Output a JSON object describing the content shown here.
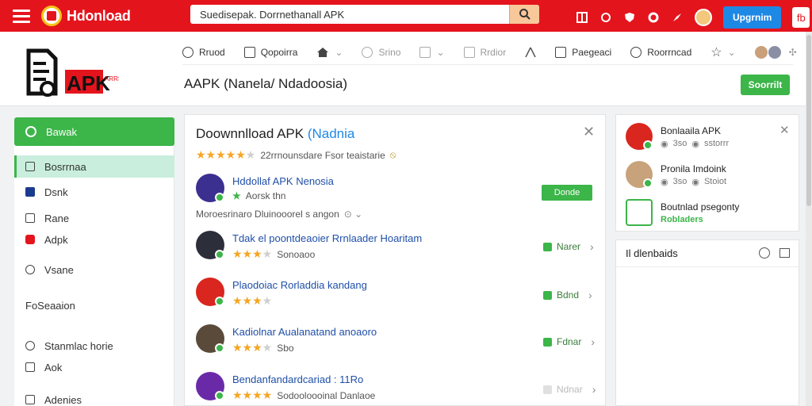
{
  "topbar": {
    "brand": "Hdonload",
    "search_value": "Suedisepak. Dorrnethanall APK",
    "upgrade_label": "Upgrnim",
    "square_label": "fb"
  },
  "nav": {
    "items": [
      {
        "label": "Rruod",
        "icon": "globe-icon"
      },
      {
        "label": "Qopoirra",
        "icon": "window-icon"
      },
      {
        "label": "",
        "icon": "home-icon"
      },
      {
        "label": "Srino",
        "icon": "search-icon"
      },
      {
        "label": "",
        "icon": "box-icon"
      },
      {
        "label": "Rrdior",
        "icon": "mail-icon"
      },
      {
        "label": "",
        "icon": "arrow-icon"
      },
      {
        "label": "Paegeaci",
        "icon": "page-icon"
      },
      {
        "label": "Roorrncad",
        "icon": "ring-icon"
      }
    ]
  },
  "header": {
    "logo_text": "APK",
    "logo_tag": "ARRS",
    "title": "AAPK (Nanela/ Ndadoosia)",
    "search_button": "Soorrilt"
  },
  "sidebar": {
    "primary_label": "Bawak",
    "items": [
      {
        "label": "Bosrrnaa",
        "icon": "box-icon",
        "active": true
      },
      {
        "label": "Dsnk",
        "icon": "flag-icon",
        "active": false
      },
      {
        "label": "Rane",
        "icon": "page-icon",
        "active": false
      },
      {
        "label": "Adpk",
        "icon": "apk-icon",
        "active": false
      },
      {
        "label": "Vsane",
        "icon": "search-icon",
        "active": false
      },
      {
        "label": "FoSeaaion",
        "icon": "",
        "active": false
      },
      {
        "label": "Stanmlac horie",
        "icon": "clock-icon",
        "active": false
      },
      {
        "label": "Aok",
        "icon": "grid-icon",
        "active": false
      },
      {
        "label": "Adenies",
        "icon": "list-icon",
        "active": false
      }
    ]
  },
  "main": {
    "title_prefix": "Doownnlload APK ",
    "title_accent": "(Nadnia",
    "rating_text": "22rrnounsdare Fsor teaistarie",
    "apps": [
      {
        "name": "Hddollaf APK Nenosia",
        "sub": "Aorsk thn",
        "action": "Donde",
        "stars": 4
      },
      {
        "name": "Tdak el poontdeaoier Rrnlaader Hoaritam",
        "sub": "Sonoaoo",
        "action": "Narer",
        "stars": 3
      },
      {
        "name": "Plaodoiac Rorladdia kandang",
        "sub": "",
        "action": "Bdnd",
        "stars": 3
      },
      {
        "name": "Kadiolnar Aualanatand anoaoro",
        "sub": "Sbo",
        "action": "Fdnar",
        "stars": 3
      },
      {
        "name": "Bendanfandardcariad : 11Ro",
        "sub": "Sodooloooinal Danlaoe",
        "action": "Ndnar",
        "stars": 4
      }
    ],
    "info_line": "Moroesrinaro  Dluinooorel s angon"
  },
  "right": {
    "items": [
      {
        "name": "Bonlaaila APK",
        "meta_a": "3so",
        "meta_b": "sstorrr"
      },
      {
        "name": "Pronila Imdoink",
        "meta_a": "3so",
        "meta_b": "Stoiot"
      },
      {
        "name": "Boutnlad psegonty",
        "green": "Robladers"
      }
    ],
    "card2_title": "Il dlenbaids"
  }
}
